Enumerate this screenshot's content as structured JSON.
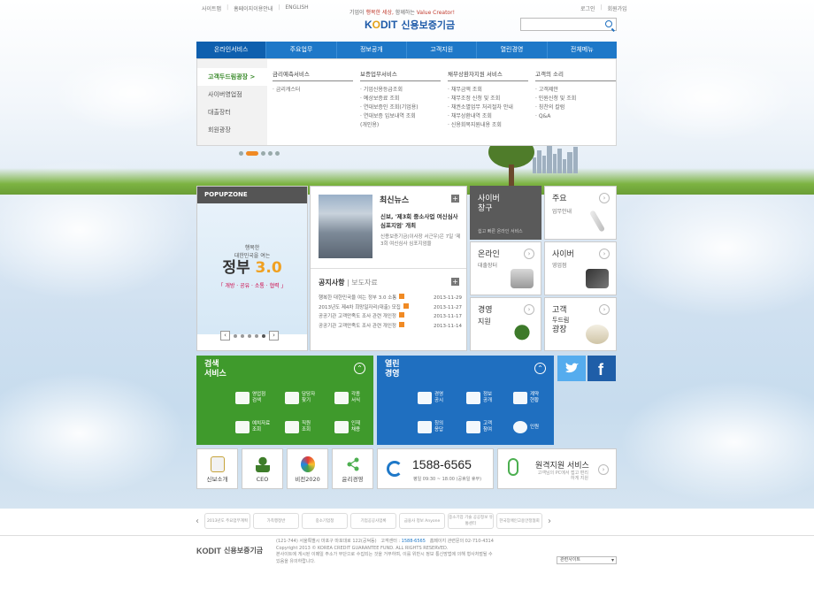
{
  "top_links": [
    "사이트맵",
    "홈페이지이용안내",
    "ENGLISH"
  ],
  "top_right_links": [
    "로그인",
    "회원가입"
  ],
  "slogan": {
    "pre": "기업이 ",
    "emph": "행복한 세상,",
    "mid": " 함께하는 ",
    "value": "Value Creator!"
  },
  "logo": {
    "mark_k": "K",
    "mark_o": "O",
    "mark_rest": "DIT",
    "name": "신용보증기금"
  },
  "gnb": [
    "온라인서비스",
    "주요업무",
    "정보공개",
    "고객지원",
    "열린경영",
    "전체메뉴"
  ],
  "mega": {
    "side": [
      "고객두드림광장 >",
      "사이버영업점",
      "대출장터",
      "회원광장"
    ],
    "cols": [
      {
        "title": "금리예측서비스",
        "items": [
          "· 금리캐스터"
        ]
      },
      {
        "title": "보증업무서비스",
        "items": [
          "· 기업신용등급조회",
          "· 예상보증료 조회",
          "· 연대보증인 조회(기업용)",
          "· 연대보증 입보내역 조회",
          "  (개인용)"
        ]
      },
      {
        "title": "채무상환자지원 서비스",
        "items": [
          "· 채무금액 조회",
          "· 채무조정 신청 및 조회",
          "· 채권소멸업무 처리절차 안내",
          "· 채무상환내역 조회",
          "· 신용회복지원내용 조회"
        ]
      },
      {
        "title": "고객의 소리",
        "items": [
          "· 고객제안",
          "· 민원신청 및 조회",
          "· 칭찬의 칼럼",
          "· Q&A"
        ]
      }
    ]
  },
  "popup": {
    "title": "POPUPZONE",
    "line1": "행복한\n대한민국을 여는",
    "big1": "정부 ",
    "big2": "3.0",
    "sub": "「 개방 · 공유 · 소통 · 협력 」"
  },
  "news": {
    "title": "최신뉴스",
    "headline": "신보, '제3회 중소사업 여신심사 심포지엄' 개최",
    "desc": "신용보증기금(이사장 서근우)은 7일 '제3회 여신심사 심포지엄을",
    "tab_active": "공지사항",
    "tab_sep": "|",
    "tab_other": "보도자료",
    "items": [
      {
        "t": "행복한 대한민국을 여는 정부 3.0 소통",
        "d": "2013-11-29"
      },
      {
        "t": "2013년도 제4차 희망일자리(대출) 모집",
        "d": "2013-11-27"
      },
      {
        "t": "공공기관 고객만족도 조사 관련 개인정",
        "d": "2013-11-17"
      },
      {
        "t": "공공기관 고객만족도 조사 관련 개인정",
        "d": "2013-11-14"
      }
    ]
  },
  "tiles": [
    {
      "l1": "사이버",
      "l2": "창구",
      "s": "쉽고 빠른 온라인 서비스"
    },
    {
      "l1": "주요",
      "s": "업무안내"
    },
    {
      "l1": "온라인",
      "s": "대출장터"
    },
    {
      "l1": "사이버",
      "s": "영업점"
    },
    {
      "l1": "경영",
      "s": "지원"
    },
    {
      "l1": "고객",
      "l2": "두드림",
      "l3": "광장"
    }
  ],
  "search_svc": {
    "t1": "검색",
    "t2": "서비스",
    "up": "⌃",
    "items": [
      [
        "영업점",
        "검색"
      ],
      [
        "담당자",
        "찾기"
      ],
      [
        "각종",
        "서식"
      ],
      [
        "예치자료",
        "조회"
      ],
      [
        "직원",
        "조회"
      ],
      [
        "인재",
        "채용"
      ]
    ]
  },
  "open_mgmt": {
    "t1": "열린",
    "t2": "경영",
    "up": "⌃",
    "items": [
      [
        "경영",
        "공시"
      ],
      [
        "정보",
        "공개"
      ],
      [
        "계약",
        "현황"
      ],
      [
        "칭의",
        "응답"
      ],
      [
        "고객",
        "참여"
      ],
      [
        "인원",
        ""
      ]
    ]
  },
  "sns": [
    "twitter-icon",
    "facebook-icon"
  ],
  "small": [
    "신보소개",
    "CEO",
    "비전2020",
    "윤리경영"
  ],
  "call": {
    "number": "1588-6565",
    "hours": "평일 09:30 ~ 18:00 (공휴일 휴무)"
  },
  "remote": {
    "title": "원격지원 서비스",
    "desc": "고객님의 PC에서 접고 편리하게 지원"
  },
  "banners": [
    "2013년도 주요업무계획",
    "가족행정반",
    "중소기업청",
    "기업공공사업록",
    "금융사 정보 Anyone",
    "중소기업 기술 공공정보 유통센터",
    "한국장애인고용안정협회"
  ],
  "footer": {
    "logo_k": "KODIT",
    "name": "신용보증기금",
    "line1_a": "(121-744) 서울특별시 마포구 마포대로 122(공덕동)",
    "line1_b": "고객센터 : ",
    "line1_num": "1588-6565",
    "line1_c": "홈페이지 관련문의 02-710-4314",
    "line2": "Copyright 2013 © KOREA CREDIT GUARANTEE FUND. ALL RIGHTS RESERVED.",
    "line3": "본사이트에 게시된 이메일 주소가 무단으로 수집되는 것을 거부하며, 이를 위반시 정보 통신망법에 의해 형사처벌될 수",
    "line4": "있음을 유의하랍니다.",
    "select": "관련사이트"
  }
}
